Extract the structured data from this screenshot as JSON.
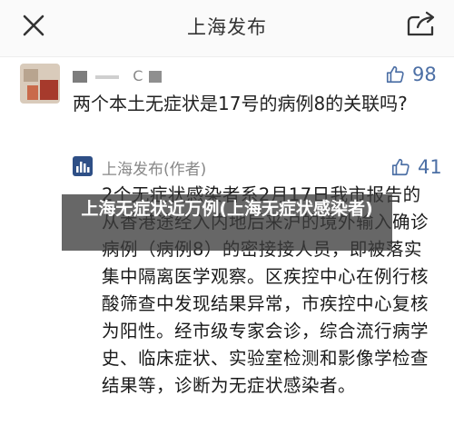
{
  "header": {
    "title": "上海发布"
  },
  "question": {
    "user_name": "C",
    "likes": "98",
    "text": "两个本土无症状是17号的病例8的关联吗?"
  },
  "answer": {
    "author": "上海发布(作者)",
    "likes": "41",
    "text": "2个无症状感染者系2月17日我市报告的从香港途经入内地后来沪的境外输入确诊病例（病例8）的密接接人员，即被落实集中隔离医学观察。区疾控中心在例行核酸筛查中发现结果异常，市疾控中心复核为阳性。经市级专家会诊，综合流行病学史、临床症状、实验室检测和影像学检查结果等，诊断为无症状感染者。"
  },
  "overlay": {
    "caption": "上海无症状近万例(上海无症状感染者)"
  },
  "colors": {
    "accent": "#4c6fa5",
    "overlay_bg": "#3c3c3c"
  }
}
